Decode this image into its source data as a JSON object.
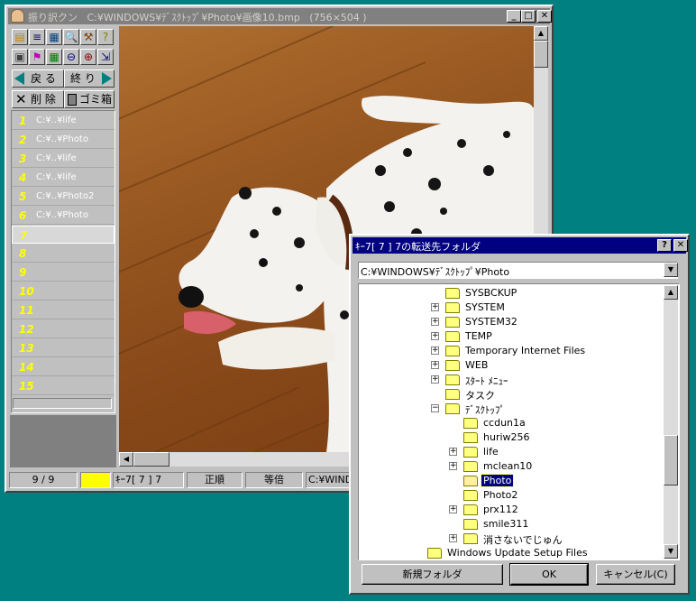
{
  "main_window": {
    "title_app": "振り訳クン",
    "title_path": "C:¥WINDOWS¥ﾃﾞｽｸﾄｯﾌﾟ¥Photo¥画像10.bmp",
    "title_dims": "(756×504 )",
    "caption_buttons": {
      "minimize": "_",
      "maximize": "□",
      "close": "✕"
    }
  },
  "toolbar": {
    "icons": [
      "open-icon",
      "rename-icon",
      "thumbnail-icon",
      "search-icon",
      "tools-icon",
      "help-icon",
      "camera-icon",
      "run-icon",
      "grid-icon",
      "zoom-out-icon",
      "zoom-in-icon",
      "arrange-icon"
    ],
    "back_label": "戻 る",
    "end_label": "終 り",
    "delete_label": "削 除",
    "trash_label": "ゴミ箱"
  },
  "slots": [
    {
      "num": "1",
      "path": "C:¥..¥life"
    },
    {
      "num": "2",
      "path": "C:¥..¥Photo"
    },
    {
      "num": "3",
      "path": "C:¥..¥life"
    },
    {
      "num": "4",
      "path": "C:¥..¥life"
    },
    {
      "num": "5",
      "path": "C:¥..¥Photo2"
    },
    {
      "num": "6",
      "path": "C:¥..¥Photo"
    },
    {
      "num": "7",
      "path": ""
    },
    {
      "num": "8",
      "path": ""
    },
    {
      "num": "9",
      "path": ""
    },
    {
      "num": "10",
      "path": ""
    },
    {
      "num": "11",
      "path": ""
    },
    {
      "num": "12",
      "path": ""
    },
    {
      "num": "13",
      "path": ""
    },
    {
      "num": "14",
      "path": ""
    },
    {
      "num": "15",
      "path": ""
    }
  ],
  "status": {
    "count": "9 / 9",
    "mode": "ｷｰ7[ 7 ] 7",
    "order": "正順",
    "scale": "等倍",
    "path": "C:¥WINDOWS"
  },
  "dialog": {
    "title": "ｷｰ7[ 7 ] 7の転送先フォルダ",
    "help_btn": "?",
    "close_btn": "✕",
    "combo_value": "C:¥WINDOWS¥ﾃﾞｽｸﾄｯﾌﾟ¥Photo",
    "tree": [
      {
        "label": "SYSBCKUP",
        "level": 0,
        "expander": ""
      },
      {
        "label": "SYSTEM",
        "level": 0,
        "expander": "+"
      },
      {
        "label": "SYSTEM32",
        "level": 0,
        "expander": "+"
      },
      {
        "label": "TEMP",
        "level": 0,
        "expander": "+"
      },
      {
        "label": "Temporary Internet Files",
        "level": 0,
        "expander": "+"
      },
      {
        "label": "WEB",
        "level": 0,
        "expander": "+"
      },
      {
        "label": "ｽﾀｰﾄ ﾒﾆｭｰ",
        "level": 0,
        "expander": "+"
      },
      {
        "label": "タスク",
        "level": 0,
        "expander": ""
      },
      {
        "label": "ﾃﾞｽｸﾄｯﾌﾟ",
        "level": 0,
        "expander": "−"
      },
      {
        "label": "ccdun1a",
        "level": 1,
        "expander": ""
      },
      {
        "label": "huriw256",
        "level": 1,
        "expander": ""
      },
      {
        "label": "life",
        "level": 1,
        "expander": "+"
      },
      {
        "label": "mclean10",
        "level": 1,
        "expander": "+"
      },
      {
        "label": "Photo",
        "level": 1,
        "expander": "",
        "selected": true
      },
      {
        "label": "Photo2",
        "level": 1,
        "expander": ""
      },
      {
        "label": "prx112",
        "level": 1,
        "expander": "+"
      },
      {
        "label": "smile311",
        "level": 1,
        "expander": ""
      },
      {
        "label": "消さないでじゅん",
        "level": 1,
        "expander": "+"
      },
      {
        "label": "Windows Update Setup Files",
        "level": -1,
        "expander": ""
      }
    ],
    "new_folder_btn": "新規フォルダ",
    "ok_btn": "OK",
    "cancel_btn": "キャンセル(C)"
  }
}
